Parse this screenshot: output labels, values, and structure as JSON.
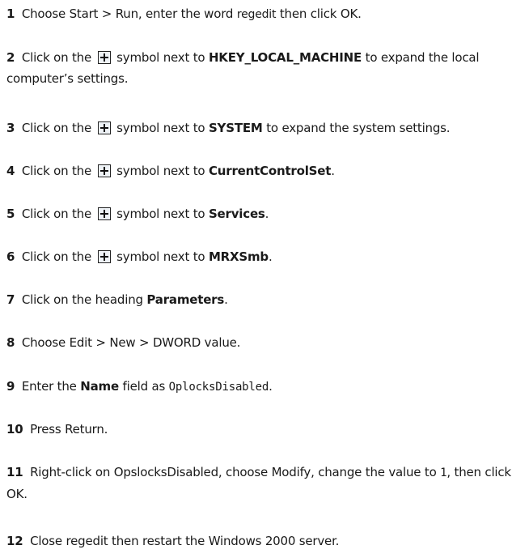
{
  "steps": [
    {
      "num": "1",
      "a": "Choose Start > Run, enter the word",
      "b": "regedit",
      "c": "then click OK."
    },
    {
      "num": "2",
      "a": "Click on the",
      "b": "symbol next to",
      "key": "HKEY_LOCAL_MACHINE",
      "c": "to expand the local computer’s settings."
    },
    {
      "num": "3",
      "a": "Click on the",
      "b": "symbol next to",
      "key": "SYSTEM",
      "c": "to expand the system settings."
    },
    {
      "num": "4",
      "a": "Click on the",
      "b": "symbol next to",
      "key": "CurrentControlSet",
      "c": "."
    },
    {
      "num": "5",
      "a": "Click on the",
      "b": "symbol next to",
      "key": "Services",
      "c": "."
    },
    {
      "num": "6",
      "a": "Click on the",
      "b": "symbol next to",
      "key": "MRXSmb",
      "c": "."
    },
    {
      "num": "7",
      "a": "Click on the heading",
      "key": "Parameters",
      "c": "."
    },
    {
      "num": "8",
      "a": "Choose Edit > New > DWORD value."
    },
    {
      "num": "9",
      "a": "Enter the",
      "key": "Name",
      "b": "field as",
      "code": "OplocksDisabled",
      "c": "."
    },
    {
      "num": "10",
      "a": "Press Return."
    },
    {
      "num": "11",
      "a": "Right-click on OpslocksDisabled, choose Modify, change the value to",
      "code": "1",
      "c": ", then click OK."
    },
    {
      "num": "12",
      "a": "Close regedit then restart the Windows 2000 server."
    }
  ],
  "icons": {
    "expand": "plus-box-icon"
  }
}
